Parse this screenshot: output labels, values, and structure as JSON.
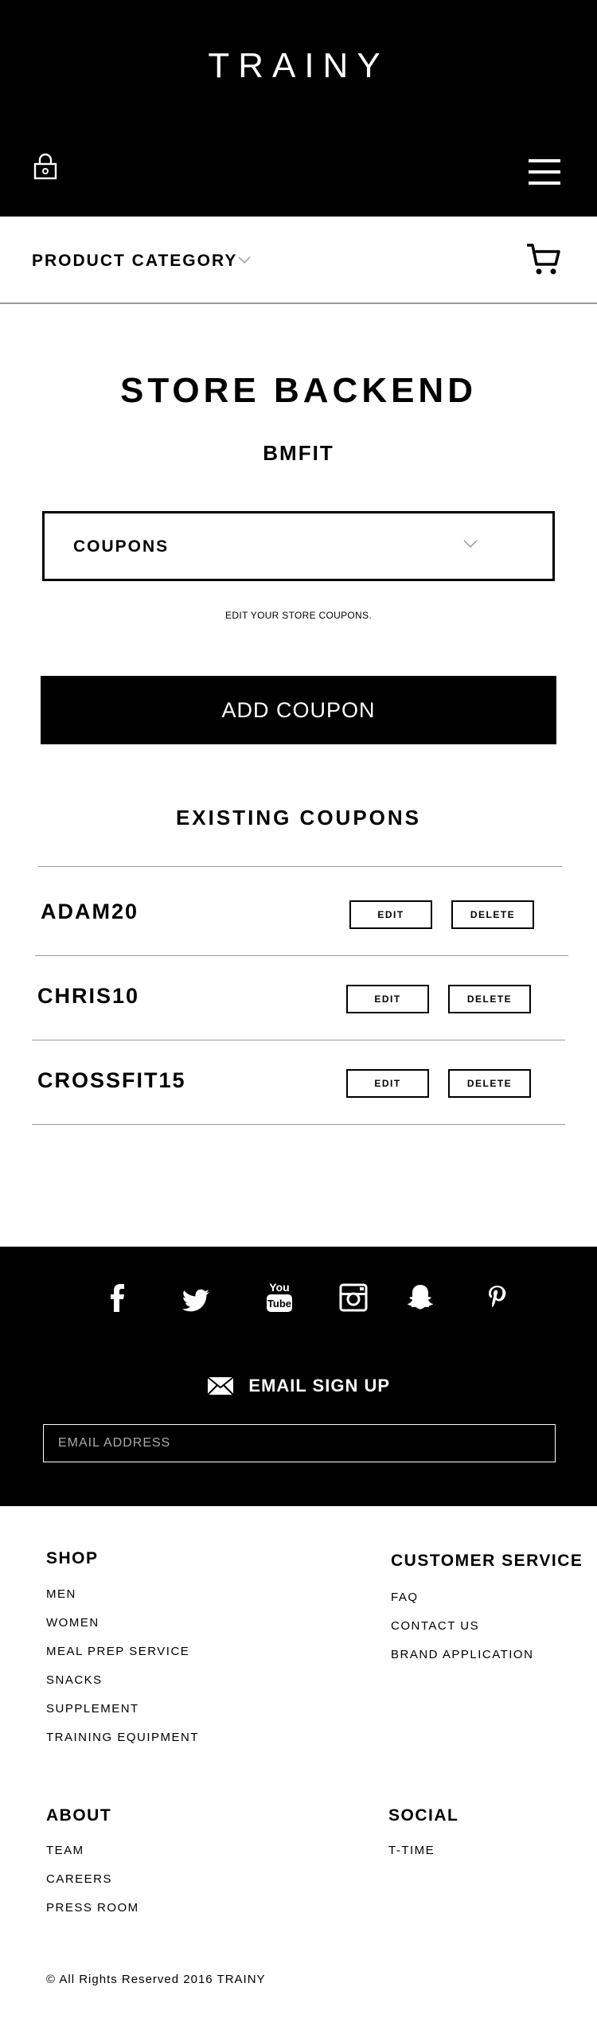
{
  "header": {
    "brand": "TRAINY",
    "colors": {
      "background": "#000000",
      "foreground": "#ffffff"
    }
  },
  "category_bar": {
    "label": "PRODUCT CATEGORY"
  },
  "main": {
    "title": "STORE BACKEND",
    "store_name": "BMFIT",
    "section_select": {
      "value": "COUPONS"
    },
    "help_text": "EDIT YOUR STORE COUPONS.",
    "add_button": "ADD COUPON",
    "existing_heading": "EXISTING COUPONS",
    "coupons": [
      {
        "code": "ADAM20",
        "edit": "EDIT",
        "delete": "DELETE"
      },
      {
        "code": "CHRIS10",
        "edit": "EDIT",
        "delete": "DELETE"
      },
      {
        "code": "CROSSFIT15",
        "edit": "EDIT",
        "delete": "DELETE"
      }
    ]
  },
  "footer": {
    "social_icons": [
      "facebook-icon",
      "twitter-icon",
      "youtube-icon",
      "instagram-icon",
      "snapchat-icon",
      "pinterest-icon"
    ],
    "email_signup": {
      "label": "EMAIL SIGN UP",
      "placeholder": "EMAIL ADDRESS"
    },
    "shop": {
      "heading": "SHOP",
      "links": [
        "MEN",
        "WOMEN",
        "MEAL PREP SERVICE",
        "SNACKS",
        "SUPPLEMENT",
        "TRAINING EQUIPMENT"
      ]
    },
    "customer_service": {
      "heading": "CUSTOMER SERVICE",
      "links": [
        "FAQ",
        "CONTACT US",
        "BRAND APPLICATION"
      ]
    },
    "about": {
      "heading": "ABOUT",
      "links": [
        "TEAM",
        "CAREERS",
        "PRESS ROOM"
      ]
    },
    "social": {
      "heading": "SOCIAL",
      "links": [
        "T-TIME"
      ]
    },
    "copyright": "© All Rights Reserved 2016 TRAINY"
  }
}
